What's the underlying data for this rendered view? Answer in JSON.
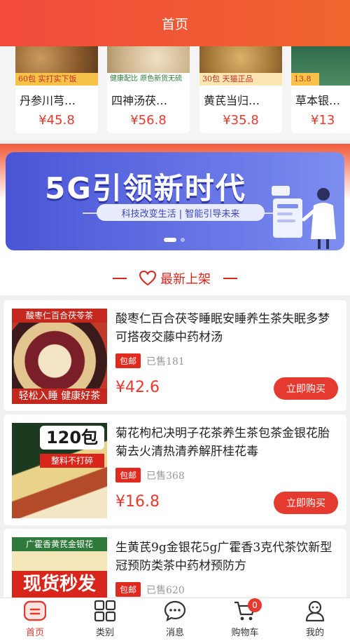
{
  "header": {
    "title": "首页"
  },
  "top_products": [
    {
      "name": "丹参川芎…",
      "price": "¥45.8",
      "thumb_text": "60包  实打实下饭"
    },
    {
      "name": "四神汤茯…",
      "price": "¥56.8",
      "thumb_text": "健康配比  原色新货无硫"
    },
    {
      "name": "黄芪当归…",
      "price": "¥35.8",
      "thumb_text": "30包  天猫正品"
    },
    {
      "name": "草本银…",
      "price": "¥13",
      "thumb_text": "13.8"
    }
  ],
  "banner": {
    "headline": "5G引领新时代",
    "subline": "科技改变生活 | 智能引导未来"
  },
  "section": {
    "title": "最新上架"
  },
  "products": [
    {
      "title": "酸枣仁百合茯苓睡眠安睡养生茶失眠多梦可搭夜交藤中药材汤",
      "tag": "包邮",
      "sold": "已售181",
      "price": "¥42.6",
      "buy_label": "立即购买",
      "img_top": "酸枣仁百合茯苓茶",
      "img_bottom": "轻松入睡 健康好茶"
    },
    {
      "title": "菊花枸杞决明子花茶养生茶包茶金银花胎菊去火清热清养解肝桂花毒",
      "tag": "包邮",
      "sold": "已售368",
      "price": "¥16.8",
      "buy_label": "立即购买",
      "img_top": "120包",
      "img_bottom": "整料不打碎"
    },
    {
      "title": "生黄芪9g金银花5g广霍香3克代茶饮新型冠预防类茶中药材预防方",
      "tag": "包邮",
      "sold": "已售620",
      "price": "",
      "buy_label": "",
      "img_top": "广霍香黄芪金银花",
      "img_bottom": "现货秒发"
    }
  ],
  "tabbar": {
    "items": [
      {
        "label": "首页",
        "icon": "home-icon"
      },
      {
        "label": "类别",
        "icon": "grid-icon"
      },
      {
        "label": "消息",
        "icon": "chat-icon"
      },
      {
        "label": "购物车",
        "icon": "cart-icon",
        "badge": "0"
      },
      {
        "label": "我的",
        "icon": "user-icon"
      }
    ]
  },
  "colors": {
    "brand": "#e53a2f",
    "header": "#f24a3c",
    "banner": "#4a55d6"
  }
}
